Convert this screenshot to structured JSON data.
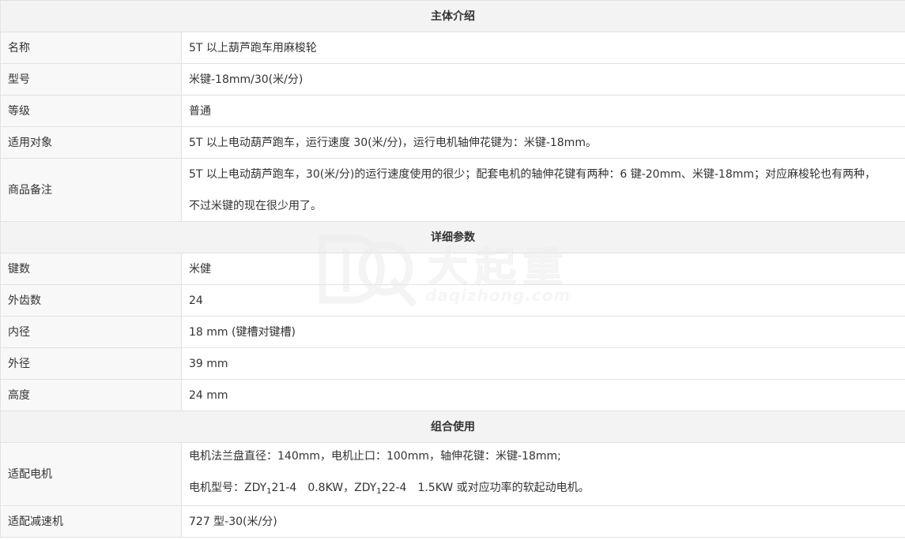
{
  "sections": {
    "intro": "主体介绍",
    "details": "详细参数",
    "combo": "组合使用"
  },
  "intro_rows": [
    {
      "label": "名称",
      "value": "5T 以上葫芦跑车用麻梭轮"
    },
    {
      "label": "型号",
      "value": "米键-18mm/30(米/分)"
    },
    {
      "label": "等级",
      "value": "普通"
    },
    {
      "label": "适用对象",
      "value": "5T 以上电动葫芦跑车，运行速度 30(米/分)，运行电机轴伸花键为：米键-18mm。"
    },
    {
      "label": "商品备注",
      "value_line1": "5T 以上电动葫芦跑车，30(米/分)的运行速度使用的很少；配套电机的轴伸花键有两种：6 键-20mm、米键-18mm；对应麻梭轮也有两种，",
      "value_line2": "不过米键的现在很少用了。"
    }
  ],
  "detail_rows": [
    {
      "label": "键数",
      "value": "米健"
    },
    {
      "label": "外齿数",
      "value": "24"
    },
    {
      "label": "内径",
      "value": "18 mm (键槽对键槽)"
    },
    {
      "label": "外径",
      "value": "39 mm"
    },
    {
      "label": "高度",
      "value": "24 mm"
    }
  ],
  "combo_rows": [
    {
      "label": "适配电机",
      "value_line1": "电机法兰盘直径：140mm，电机止口：100mm，轴伸花键：米键-18mm;",
      "line2_prefix": "电机型号：ZDY",
      "line2_sub1": "1",
      "line2_part2": "21-4",
      "line2_part3": "0.8KW，ZDY",
      "line2_sub2": "1",
      "line2_part4": "22-4",
      "line2_part5": "1.5KW 或对应功率的软起动电机。"
    },
    {
      "label": "适配减速机",
      "value": "727 型-30(米/分)"
    }
  ],
  "watermark": {
    "text_cn": "大起重",
    "text_en": "daqizhong.com",
    "logo_letters": "DQ",
    "color": "#eeeeee"
  },
  "colors": {
    "border": "#e2e2e2",
    "section_bg": "#f3f3f3",
    "label_bg": "#f8f8f8",
    "text": "#333333"
  }
}
